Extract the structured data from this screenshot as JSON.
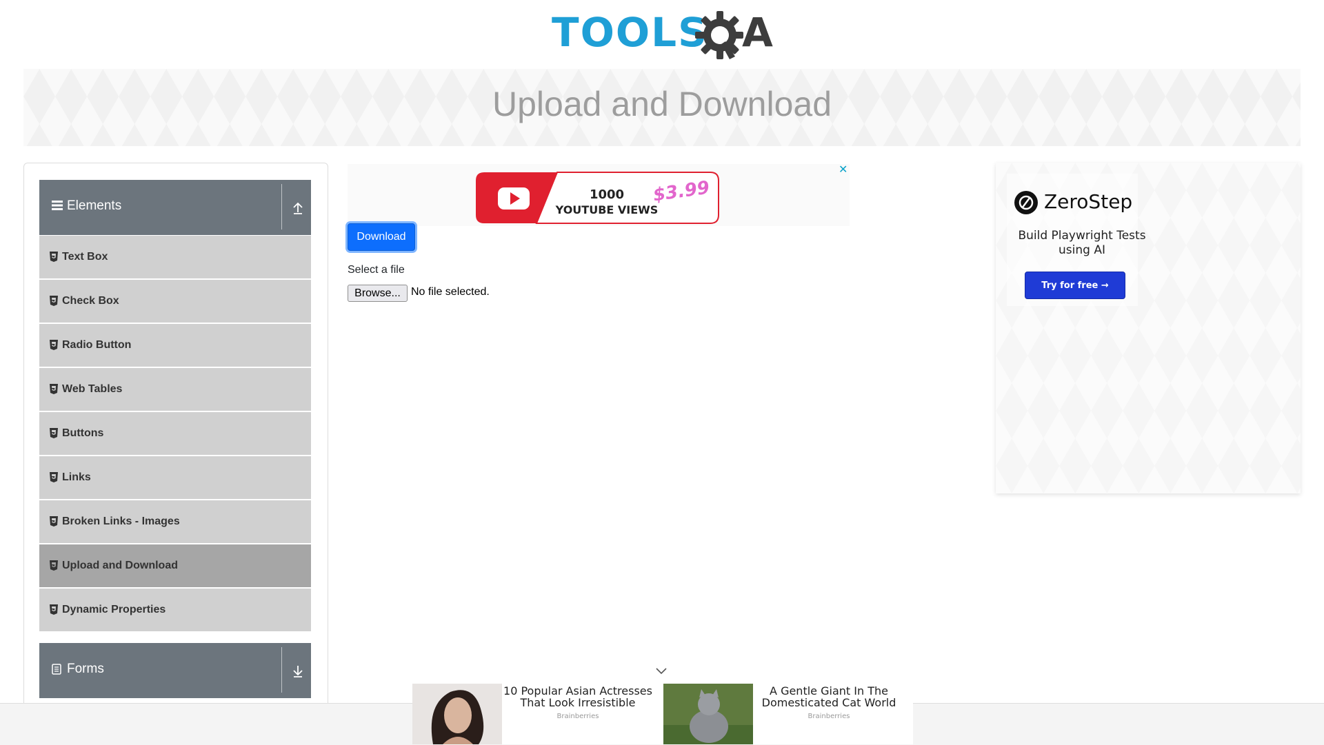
{
  "header": {
    "logo_text": "TOOLS",
    "logo_suffix": "A"
  },
  "page_title": "Upload and Download",
  "sidebar": {
    "groups": [
      {
        "title": "Elements",
        "expanded": true
      },
      {
        "title": "Forms",
        "expanded": false
      }
    ],
    "items": [
      {
        "label": "Text Box",
        "active": false
      },
      {
        "label": "Check Box",
        "active": false
      },
      {
        "label": "Radio Button",
        "active": false
      },
      {
        "label": "Web Tables",
        "active": false
      },
      {
        "label": "Buttons",
        "active": false
      },
      {
        "label": "Links",
        "active": false
      },
      {
        "label": "Broken Links - Images",
        "active": false
      },
      {
        "label": "Upload and Download",
        "active": true
      },
      {
        "label": "Dynamic Properties",
        "active": false
      }
    ]
  },
  "main": {
    "download_label": "Download",
    "select_label": "Select a file",
    "browse_label": "Browse...",
    "file_status": "No file selected."
  },
  "ad_top": {
    "close_symbol": "✕",
    "line1": "1000",
    "line2": "YOUTUBE VIEWS",
    "price": "$3.99"
  },
  "ad_right": {
    "brand": "ZeroStep",
    "tagline": "Build Playwright Tests using AI",
    "cta": "Try for free →"
  },
  "bottom_ads": [
    {
      "title": "10 Popular Asian Actresses That Look Irresistible",
      "source": "Brainberries"
    },
    {
      "title": "A Gentle Giant In The Domesticated Cat World",
      "source": "Brainberries"
    }
  ],
  "colors": {
    "logo_blue": "#1f9fd6",
    "logo_dark": "#3d3d3d",
    "header_gray": "#6c757d",
    "menu_item": "#d0d0d0",
    "menu_active": "#a6a6a6",
    "primary": "#0d6efd",
    "cta_blue": "#1f3bd6"
  }
}
